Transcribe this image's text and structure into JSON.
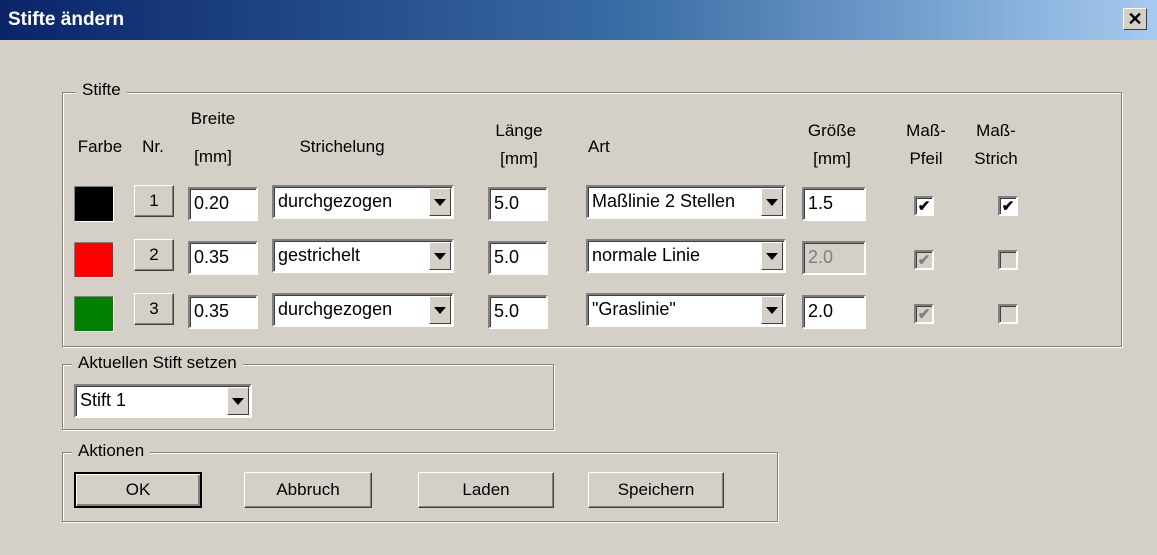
{
  "window": {
    "title": "Stifte ändern",
    "close_glyph": "✕"
  },
  "pens_group": {
    "legend": "Stifte",
    "headers": {
      "farbe": "Farbe",
      "nr": "Nr.",
      "breite_1": "Breite",
      "breite_2": "[mm]",
      "strichelung": "Strichelung",
      "laenge_1": "Länge",
      "laenge_2": "[mm]",
      "art": "Art",
      "groesse_1": "Größe",
      "groesse_2": "[mm]",
      "pfeil_1": "Maß-",
      "pfeil_2": "Pfeil",
      "strich_1": "Maß-",
      "strich_2": "Strich"
    },
    "rows": [
      {
        "color": "#000000",
        "nr": "1",
        "breite": "0.20",
        "strichelung": "durchgezogen",
        "laenge": "5.0",
        "art": "Maßlinie 2 Stellen",
        "groesse": "1.5",
        "groesse_enabled": true,
        "pfeil_checked": true,
        "pfeil_enabled": true,
        "strich_checked": true,
        "strich_enabled": true
      },
      {
        "color": "#ff0000",
        "nr": "2",
        "breite": "0.35",
        "strichelung": "gestrichelt",
        "laenge": "5.0",
        "art": "normale Linie",
        "groesse": "2.0",
        "groesse_enabled": false,
        "pfeil_checked": true,
        "pfeil_enabled": false,
        "strich_checked": false,
        "strich_enabled": true
      },
      {
        "color": "#008000",
        "nr": "3",
        "breite": "0.35",
        "strichelung": "durchgezogen",
        "laenge": "5.0",
        "art": "\"Graslinie\"",
        "groesse": "2.0",
        "groesse_enabled": true,
        "pfeil_checked": true,
        "pfeil_enabled": false,
        "strich_checked": false,
        "strich_enabled": true
      }
    ]
  },
  "current_pen_group": {
    "legend": "Aktuellen Stift setzen",
    "selected": "Stift 1"
  },
  "actions_group": {
    "legend": "Aktionen",
    "ok": "OK",
    "cancel": "Abbruch",
    "load": "Laden",
    "save": "Speichern"
  },
  "icons": {
    "check": "✔",
    "dropdown": "dropdown-arrow-icon",
    "close": "close-icon"
  }
}
